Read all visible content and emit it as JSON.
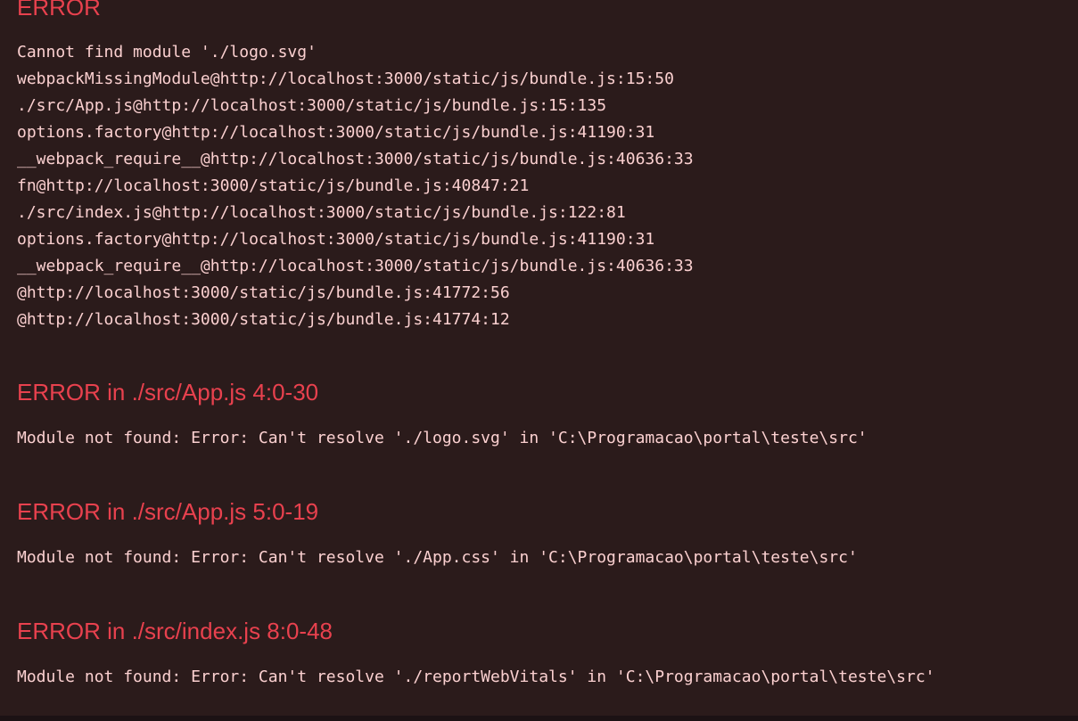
{
  "overlay": {
    "background_color": "#2b1b1b",
    "heading_color": "#e8414e",
    "body_text_color": "#fbd0d0",
    "scrollbar_color": "#1c1214"
  },
  "title_heading": "ERROR",
  "stack_trace": [
    "Cannot find module './logo.svg'",
    "webpackMissingModule@http://localhost:3000/static/js/bundle.js:15:50",
    "./src/App.js@http://localhost:3000/static/js/bundle.js:15:135",
    "options.factory@http://localhost:3000/static/js/bundle.js:41190:31",
    "__webpack_require__@http://localhost:3000/static/js/bundle.js:40636:33",
    "fn@http://localhost:3000/static/js/bundle.js:40847:21",
    "./src/index.js@http://localhost:3000/static/js/bundle.js:122:81",
    "options.factory@http://localhost:3000/static/js/bundle.js:41190:31",
    "__webpack_require__@http://localhost:3000/static/js/bundle.js:40636:33",
    "@http://localhost:3000/static/js/bundle.js:41772:56",
    "@http://localhost:3000/static/js/bundle.js:41774:12"
  ],
  "error_sections": [
    {
      "heading": "ERROR in ./src/App.js 4:0-30",
      "message": "Module not found: Error: Can't resolve './logo.svg' in 'C:\\Programacao\\portal\\teste\\src'"
    },
    {
      "heading": "ERROR in ./src/App.js 5:0-19",
      "message": "Module not found: Error: Can't resolve './App.css' in 'C:\\Programacao\\portal\\teste\\src'"
    },
    {
      "heading": "ERROR in ./src/index.js 8:0-48",
      "message": "Module not found: Error: Can't resolve './reportWebVitals' in 'C:\\Programacao\\portal\\teste\\src'"
    }
  ]
}
